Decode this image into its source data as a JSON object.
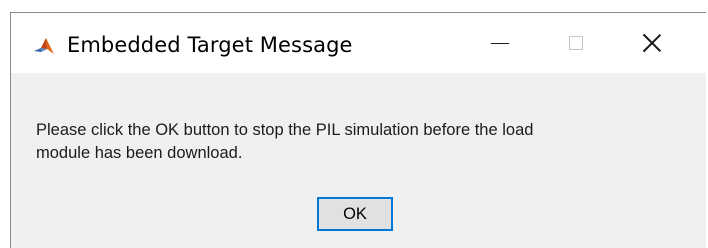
{
  "window": {
    "title": "Embedded Target Message",
    "icon": "matlab-icon",
    "controls": {
      "minimize_icon": "minimize-icon",
      "maximize_icon": "maximize-icon",
      "close_icon": "close-icon"
    }
  },
  "message": {
    "line1": "Please click the OK button to stop the PIL simulation before the load",
    "line2": "module has been download."
  },
  "buttons": {
    "ok_label": "OK"
  },
  "colors": {
    "focus_border": "#0078d7",
    "dialog_background": "#f0f0f0",
    "titlebar_background": "#ffffff"
  }
}
